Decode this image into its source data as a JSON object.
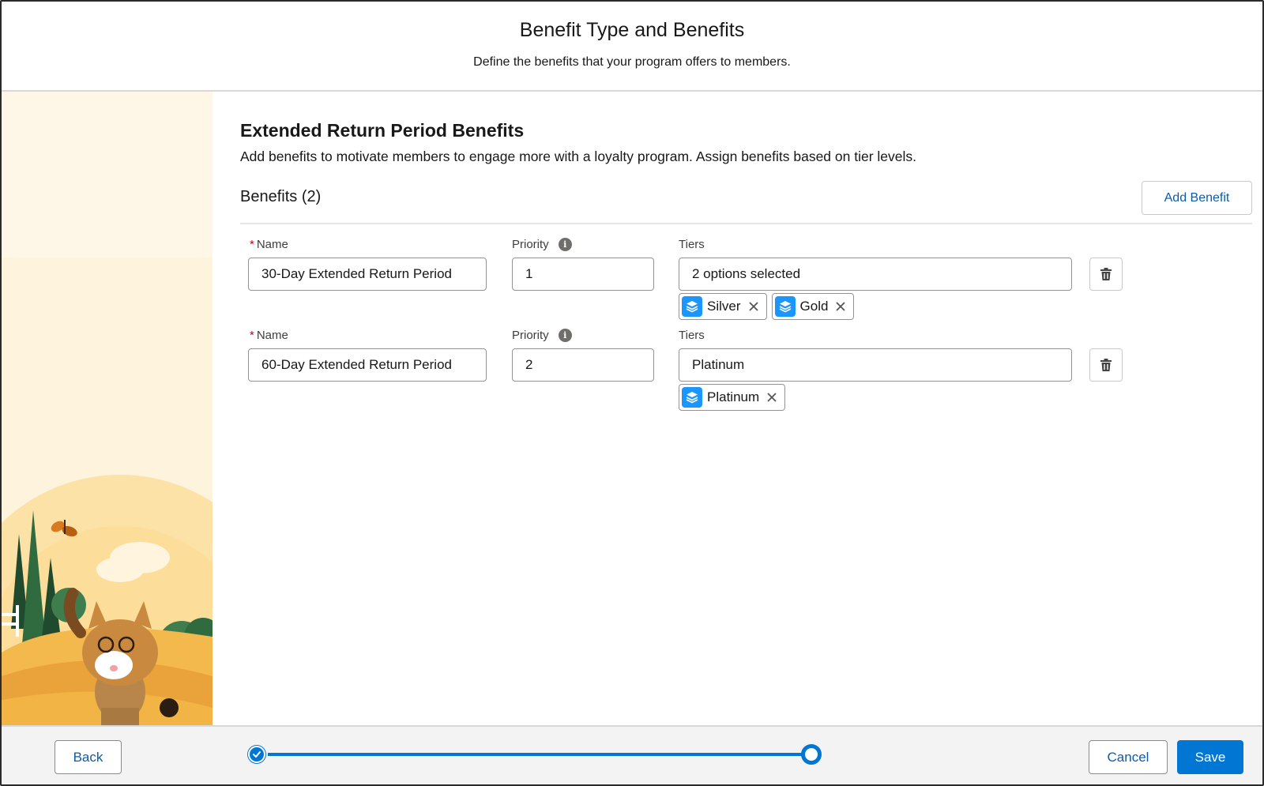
{
  "header": {
    "title": "Benefit Type and Benefits",
    "subtitle": "Define the benefits that your program offers to members."
  },
  "section": {
    "title": "Extended Return Period Benefits",
    "description": "Add benefits to motivate members to engage more with a loyalty program. Assign benefits based on tier levels.",
    "benefits_heading": "Benefits (2)",
    "add_benefit_label": "Add Benefit"
  },
  "labels": {
    "name": "Name",
    "priority": "Priority",
    "tiers": "Tiers",
    "required_marker": "*",
    "info_glyph": "i"
  },
  "benefits": [
    {
      "name": "30-Day Extended Return Period",
      "priority": "1",
      "tiers_display": "2 options selected",
      "tiers": [
        "Silver",
        "Gold"
      ]
    },
    {
      "name": "60-Day Extended Return Period",
      "priority": "2",
      "tiers_display": "Platinum",
      "tiers": [
        "Platinum"
      ]
    }
  ],
  "footer": {
    "back_label": "Back",
    "cancel_label": "Cancel",
    "save_label": "Save",
    "progress_steps_completed": 1,
    "progress_steps_total": 2
  },
  "icons": {
    "tier_pill": "tier-layers-icon",
    "remove_pill": "close-icon",
    "delete_row": "trash-icon",
    "info": "info-icon",
    "step_done": "check-icon"
  },
  "colors": {
    "brand": "#0176d3",
    "link": "#0b5cab",
    "required": "#ba0517",
    "tier_icon": "#1b96ff",
    "illustration_bg": "#fef3dd"
  }
}
